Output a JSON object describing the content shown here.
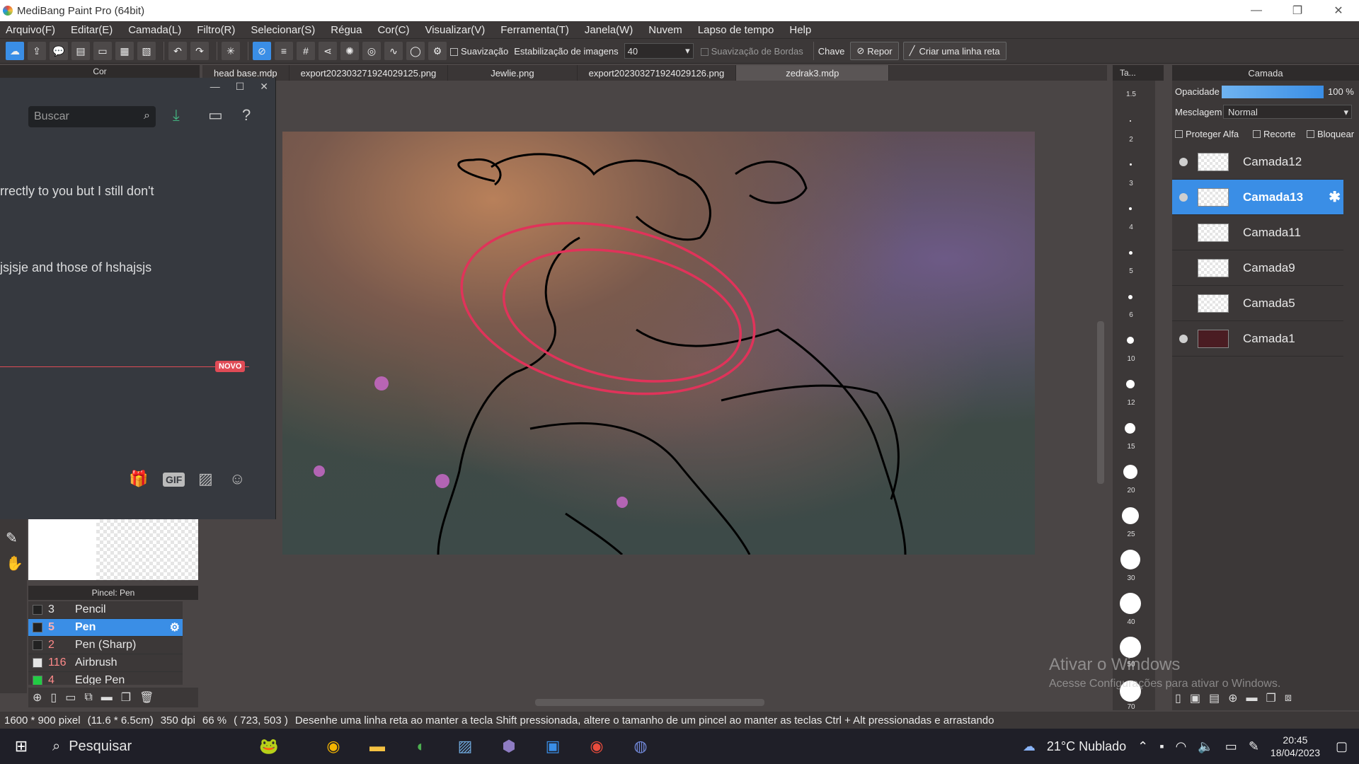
{
  "window": {
    "title": "MediBang Paint Pro (64bit)"
  },
  "menu": [
    "Arquivo(F)",
    "Editar(E)",
    "Camada(L)",
    "Filtro(R)",
    "Selecionar(S)",
    "Régua",
    "Cor(C)",
    "Visualizar(V)",
    "Ferramenta(T)",
    "Janela(W)",
    "Nuvem",
    "Lapso de tempo",
    "Help"
  ],
  "toolbar": {
    "smoothing_label": "Suavização",
    "stabilization_label": "Estabilização de imagens",
    "stabilization_value": "40",
    "edge_smoothing_label": "Suavização de Bordas",
    "key_label": "Chave",
    "reset_label": "Repor",
    "straight_line_label": "Criar uma linha reta"
  },
  "tabs": [
    "head base.mdp",
    "export202303271924029125.png",
    "Jewlie.png",
    "export202303271924029126.png",
    "zedrak3.mdp"
  ],
  "active_tab": 4,
  "color_panel": {
    "title": "Cor"
  },
  "chat": {
    "search_placeholder": "Buscar",
    "message1": "rrectly to you but I still don't",
    "message2": "jsjsje and those of hshajsjs",
    "new_badge": "NOVO",
    "gif_label": "GIF"
  },
  "brush_panel": {
    "title": "Pincel: Pen",
    "items": [
      {
        "size": "3",
        "name": "Pencil",
        "color": "#222222"
      },
      {
        "size": "5",
        "name": "Pen",
        "color": "#222222"
      },
      {
        "size": "2",
        "name": "Pen (Sharp)",
        "color": "#222222"
      },
      {
        "size": "116",
        "name": "Airbrush",
        "color": "#e5e5e5"
      },
      {
        "size": "4",
        "name": "Edge Pen",
        "color": "#22cc44"
      }
    ]
  },
  "size_panel": {
    "title": "Ta...",
    "sizes": [
      "1.5",
      "2",
      "3",
      "4",
      "5",
      "6",
      "10",
      "12",
      "15",
      "20",
      "25",
      "30",
      "40",
      "50",
      "70"
    ]
  },
  "layer_panel": {
    "title": "Camada",
    "opacity_label": "Opacidade",
    "opacity_value": "100 %",
    "opacity_fraction": 1.0,
    "blend_label": "Mesclagem",
    "blend_value": "Normal",
    "protect_alpha_label": "Proteger Alfa",
    "clip_label": "Recorte",
    "lock_label": "Bloquear",
    "layers": [
      {
        "name": "Camada12",
        "visible": true,
        "selected": false,
        "dark": false
      },
      {
        "name": "Camada13",
        "visible": true,
        "selected": true,
        "dark": false
      },
      {
        "name": "Camada11",
        "visible": false,
        "selected": false,
        "dark": false
      },
      {
        "name": "Camada9",
        "visible": false,
        "selected": false,
        "dark": false
      },
      {
        "name": "Camada5",
        "visible": false,
        "selected": false,
        "dark": false
      },
      {
        "name": "Camada1",
        "visible": true,
        "selected": false,
        "dark": true
      }
    ]
  },
  "status": {
    "pixels": "1600 * 900 pixel",
    "cm": "(11.6 * 6.5cm)",
    "dpi": "350 dpi",
    "zoom": "66 %",
    "cursor": "( 723, 503 )",
    "hint": "Desenhe uma linha reta ao manter a tecla Shift pressionada, altere o tamanho de um pincel ao manter as teclas Ctrl + Alt pressionadas e arrastando"
  },
  "watermark": {
    "line1": "Ativar o Windows",
    "line2": "Acesse Configurações para ativar o Windows."
  },
  "taskbar": {
    "search_label": "Pesquisar",
    "weather": "21°C  Nublado",
    "time": "20:45",
    "date": "18/04/2023"
  },
  "colors": {
    "accent": "#3a8ee6",
    "panel": "#3c3838",
    "canvas_bg": "#4a4545",
    "novo": "#e04b56"
  }
}
